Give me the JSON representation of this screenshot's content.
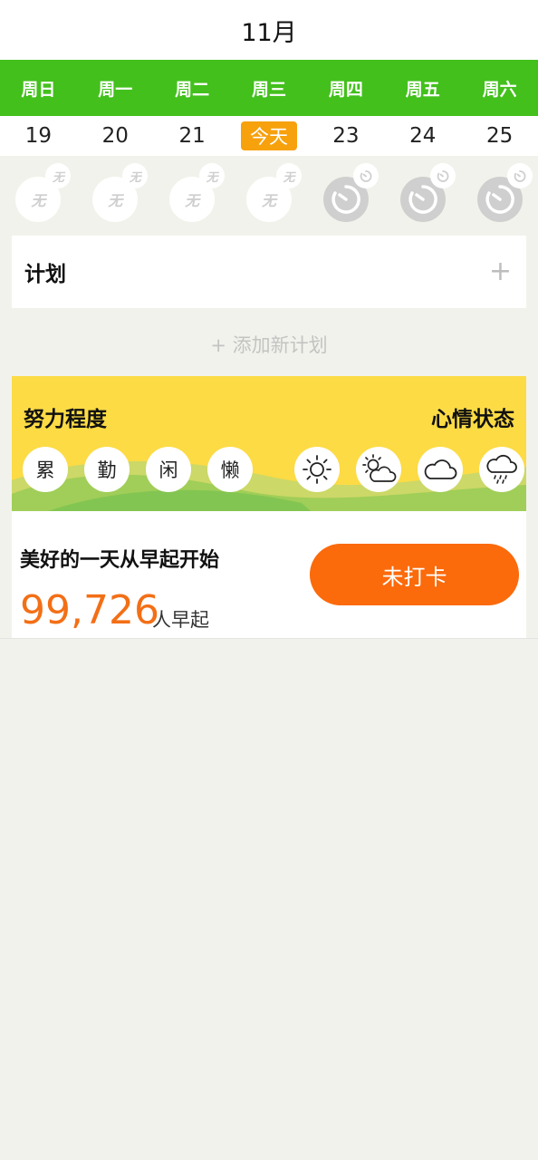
{
  "header": {
    "month": "11月"
  },
  "weekdays": [
    "周日",
    "周一",
    "周二",
    "周三",
    "周四",
    "周五",
    "周六"
  ],
  "dates": [
    "19",
    "20",
    "21",
    "今天",
    "23",
    "24",
    "25"
  ],
  "day_status": [
    {
      "state": "none",
      "badge": "无",
      "main": "无"
    },
    {
      "state": "none",
      "badge": "无",
      "main": "无"
    },
    {
      "state": "none",
      "badge": "无",
      "main": "无"
    },
    {
      "state": "none",
      "badge": "无",
      "main": "无"
    },
    {
      "state": "alarm",
      "icon": "alarm-icon"
    },
    {
      "state": "alarm",
      "icon": "alarm-icon"
    },
    {
      "state": "alarm",
      "icon": "alarm-icon"
    }
  ],
  "plan": {
    "title": "计划",
    "add_icon": "plus-icon",
    "add_new_label": "+ 添加新计划"
  },
  "mood": {
    "effort_title": "努力程度",
    "mood_title": "心情状态",
    "effort_options": [
      "累",
      "勤",
      "闲",
      "懒"
    ],
    "weather_icons": [
      "sunny-icon",
      "partly-cloudy-icon",
      "cloudy-icon",
      "rain-icon"
    ]
  },
  "checkin": {
    "slogan": "美好的一天从早起开始",
    "count": "99,726",
    "count_unit": "人早起",
    "button_label": "未打卡"
  },
  "colors": {
    "green": "#43c01c",
    "today": "#f7a10d",
    "panel_yellow": "#fcdb45",
    "orange": "#fb6a0b",
    "count_orange": "#f36f16"
  }
}
